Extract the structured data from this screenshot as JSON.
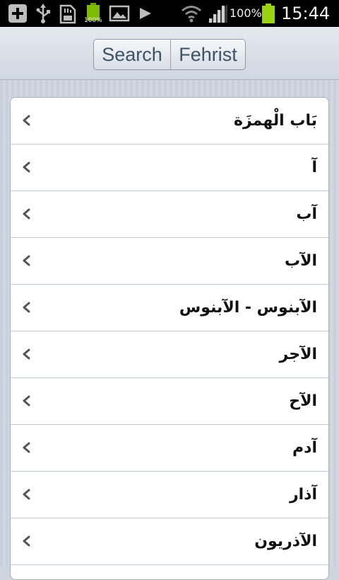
{
  "status_bar": {
    "battery_percent": "100%",
    "small_battery_label": "100%",
    "time": "15:44",
    "icons": [
      "add-icon",
      "usb-icon",
      "sd-card-icon",
      "battery-notification-icon",
      "image-icon",
      "play-icon",
      "wifi-icon",
      "signal-icon",
      "battery-icon"
    ],
    "battery_level": 1.0,
    "battery_color": "#9bd40f"
  },
  "toolbar": {
    "search_label": "Search",
    "index_label": "Fehrist"
  },
  "list": {
    "items": [
      {
        "label": "بَاب الْهمزَة"
      },
      {
        "label": "آ"
      },
      {
        "label": "آب"
      },
      {
        "label": "الآب"
      },
      {
        "label": "الآبنوس - الآبنوس"
      },
      {
        "label": "الآجر"
      },
      {
        "label": "الآح"
      },
      {
        "label": "آدم"
      },
      {
        "label": "آذار"
      },
      {
        "label": "الآذريون"
      }
    ],
    "chevron_icon": "chevron-left-icon"
  }
}
